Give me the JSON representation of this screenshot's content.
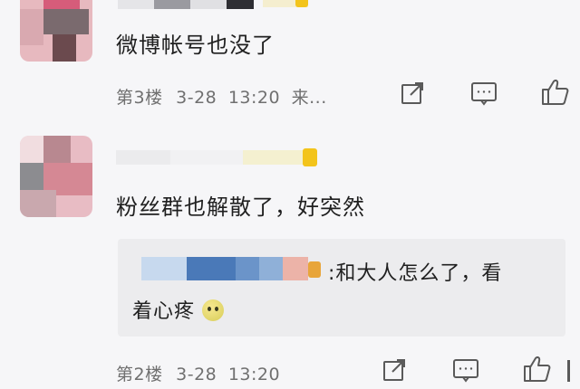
{
  "comments": [
    {
      "text": "微博帐号也没了",
      "floor": "第3楼",
      "date": "3-28",
      "time": "13:20",
      "source": "来..."
    },
    {
      "text": "粉丝群也解散了，好突然",
      "floor": "第2楼",
      "date": "3-28",
      "time": "13:20",
      "reply": {
        "line1": ":和大人怎么了，看",
        "line2": "着心疼"
      }
    }
  ],
  "icons": {
    "share": "share-icon",
    "comment": "comment-icon",
    "like": "like-icon",
    "emoji": "sweat-emoji-icon"
  },
  "colors": {
    "background": "#f6f6f8",
    "reply_background": "#ececee",
    "meta_text": "#707070",
    "vip_badge": "#f3c41b"
  }
}
